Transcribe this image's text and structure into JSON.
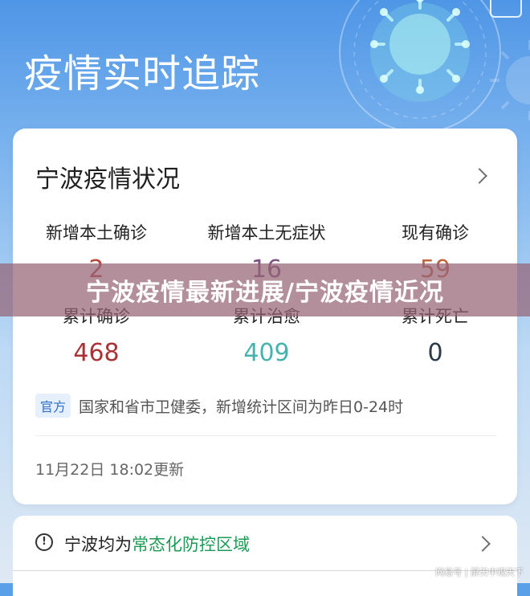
{
  "hero": {
    "title": "疫情实时追踪",
    "virus_icon": "virus-icon",
    "share_icon": "share-icon"
  },
  "card": {
    "title": "宁波疫情状况",
    "stats": [
      {
        "label": "新增本土确诊",
        "value": "2",
        "color": "#b8463c"
      },
      {
        "label": "新增本土无症状",
        "value": "16",
        "color": "#7a5280"
      },
      {
        "label": "现有确诊",
        "value": "59",
        "color": "#c2653d"
      },
      {
        "label": "累计确诊",
        "value": "468",
        "color": "#a83235"
      },
      {
        "label": "累计治愈",
        "value": "409",
        "color": "#48b3ae"
      },
      {
        "label": "累计死亡",
        "value": "0",
        "color": "#2b3a4a"
      }
    ],
    "official_tag": "官方",
    "official_text": "国家和省市卫健委，新增统计区间为昨日0-24时",
    "update_time": "11月22日 18:02更新"
  },
  "risk": {
    "prefix": "宁波均为",
    "highlight": "常态化防控区域",
    "highlight_color": "#1f9a55"
  },
  "banner": {
    "text": "宁波疫情最新进展/宁波疫情近况"
  },
  "watermark": {
    "text": "网易号 | 屏天中观天下"
  }
}
